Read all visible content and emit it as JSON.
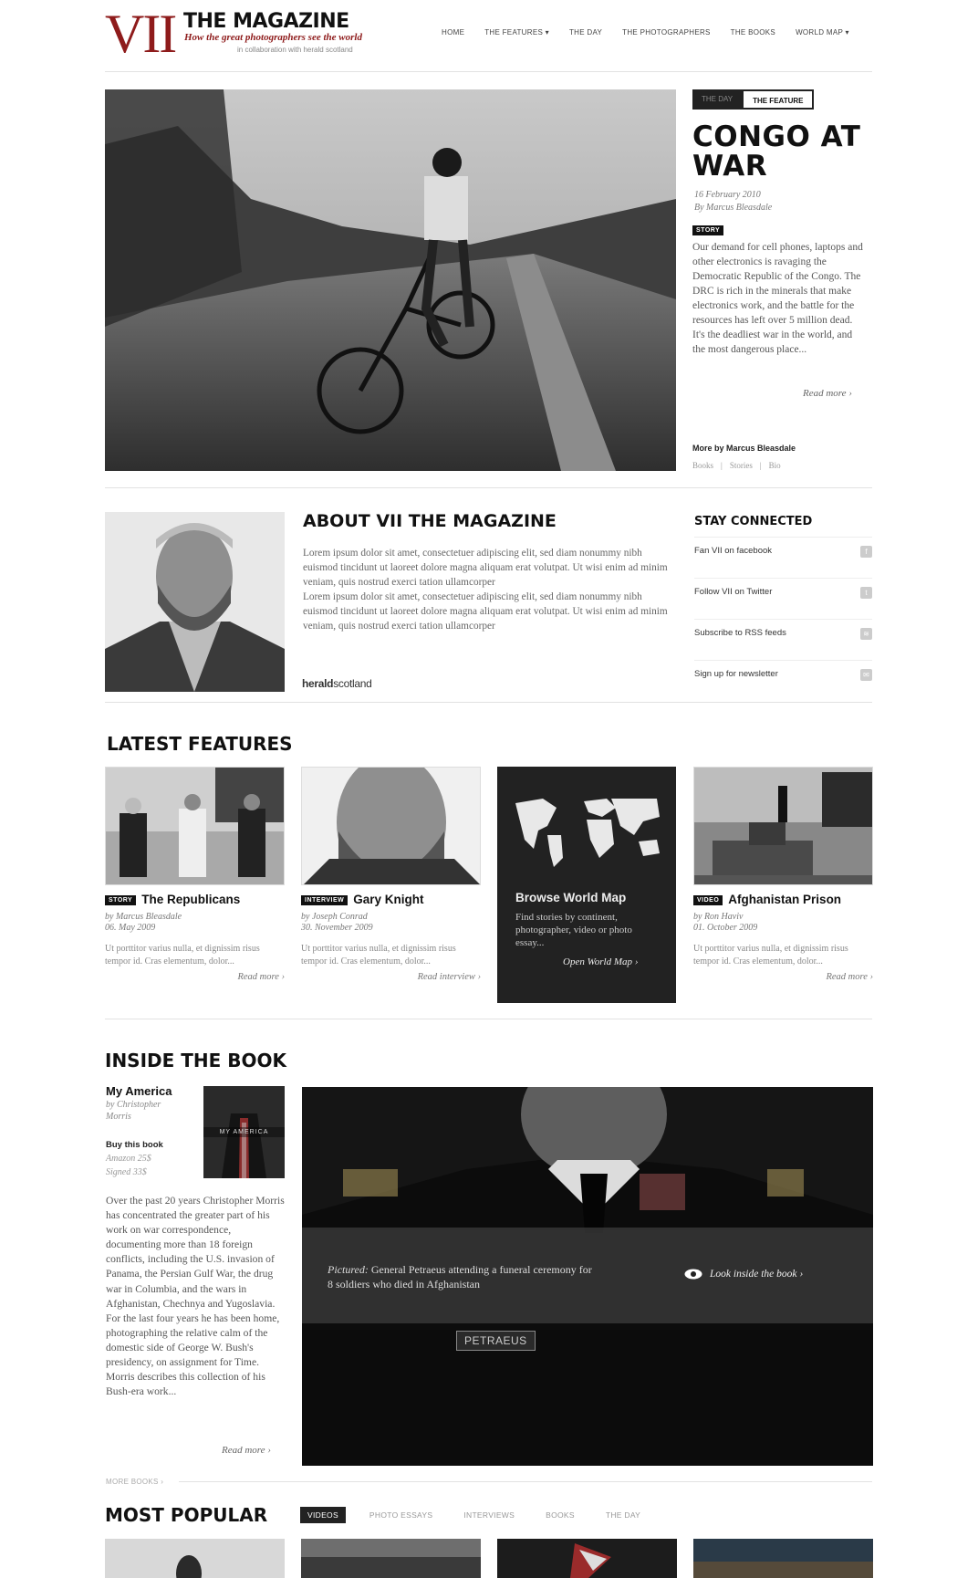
{
  "header": {
    "logo": "VII",
    "title": "THE MAGAZINE",
    "tagline": "How the great photographers see the world",
    "collab": "in collaboration with herald scotland",
    "nav": [
      "HOME",
      "THE FEATURES ▾",
      "THE DAY",
      "THE PHOTOGRAPHERS",
      "THE BOOKS",
      "WORLD MAP ▾"
    ]
  },
  "hero": {
    "tabs": [
      "THE DAY",
      "THE FEATURE"
    ],
    "active_tab": "THE FEATURE",
    "title": "CONGO AT WAR",
    "date": "16 February 2010",
    "author": "By Marcus Bleasdale",
    "badge": "STORY",
    "body": "Our demand for cell phones, laptops and other electronics is ravaging the Democratic Republic of the Congo. The DRC is rich in the minerals that make electronics work, and the battle for the resources has left over 5 million dead. It's the deadliest war in the world, and the most dangerous place...",
    "read_more": "Read more ›",
    "more_by": "More by Marcus Bleasdale",
    "more_links": [
      "Books",
      "|",
      "Stories",
      "|",
      "Bio"
    ]
  },
  "about": {
    "title": "ABOUT VII THE MAGAZINE",
    "body1": "Lorem ipsum dolor sit amet, consectetuer adipiscing elit, sed diam nonummy nibh euismod tincidunt ut laoreet dolore magna aliquam erat volutpat. Ut wisi enim ad minim veniam, quis nostrud exerci tation ullamcorper",
    "body2": "Lorem ipsum dolor sit amet, consectetuer adipiscing elit, sed diam nonummy nibh euismod tincidunt ut laoreet dolore magna aliquam erat volutpat. Ut wisi enim ad minim veniam, quis nostrud exerci tation ullamcorper",
    "herald_bold": "herald",
    "herald_rest": "scotland"
  },
  "stay": {
    "title": "STAY CONNECTED",
    "items": [
      {
        "label": "Fan VII on facebook",
        "icon": "f"
      },
      {
        "label": "Follow VII on Twitter",
        "icon": "t"
      },
      {
        "label": "Subscribe to RSS feeds",
        "icon": "≋"
      },
      {
        "label": "Sign up for newsletter",
        "icon": "✉"
      }
    ]
  },
  "latest": {
    "title": "LATEST FEATURES",
    "cards": [
      {
        "badge": "STORY",
        "title": "The Republicans",
        "by": "by Marcus Bleasdale",
        "date": "06. May 2009",
        "excerpt": "Ut porttitor varius nulla, et dignissim risus tempor id. Cras elementum, dolor...",
        "more": "Read more ›"
      },
      {
        "badge": "INTERVIEW",
        "title": "Gary Knight",
        "by": "by Joseph Conrad",
        "date": "30. November 2009",
        "excerpt": "Ut porttitor varius nulla, et dignissim risus tempor id. Cras elementum, dolor...",
        "more": "Read interview ›"
      },
      {
        "badge": "VIDEO",
        "title": "Afghanistan Prison",
        "by": "by Ron Haviv",
        "date": "01. October 2009",
        "excerpt": "Ut porttitor varius nulla, et dignissim risus tempor id. Cras elementum, dolor...",
        "more": "Read more ›"
      }
    ],
    "map": {
      "title": "Browse World Map",
      "excerpt": "Find stories by continent, photographer, video or photo essay...",
      "more": "Open World Map ›"
    }
  },
  "book": {
    "section_title": "INSIDE THE BOOK",
    "name": "My America",
    "author": "by Christopher Morris",
    "buy_title": "Buy this book",
    "amazon": "Amazon 25$",
    "signed": "Signed 33$",
    "cover_text": "MY AMERICA",
    "body": "Over the past 20 years Christopher Morris has concentrated the greater part of his work on war correspondence, documenting more than 18 foreign conflicts, including the U.S. invasion of Panama, the Persian Gulf War, the drug war in Columbia, and the wars in Afghanistan, Chechnya and Yugoslavia. For the last four years he has been home, photographing the relative calm of the domestic side of George W. Bush's presidency, on assignment for Time. Morris describes this collection of his Bush-era work...",
    "read_more": "Read more ›",
    "caption_label": "Pictured:",
    "caption": "General Petraeus attending a funeral ceremony for 8 soldiers who died in Afghanistan",
    "look_inside": "Look inside the book ›",
    "nameplate": "PETRAEUS",
    "more_books": "MORE BOOKS ›"
  },
  "popular": {
    "title": "MOST POPULAR",
    "tabs": [
      "VIDEOS",
      "PHOTO ESSAYS",
      "INTERVIEWS",
      "BOOKS",
      "THE DAY"
    ],
    "active_tab": "VIDEOS"
  }
}
